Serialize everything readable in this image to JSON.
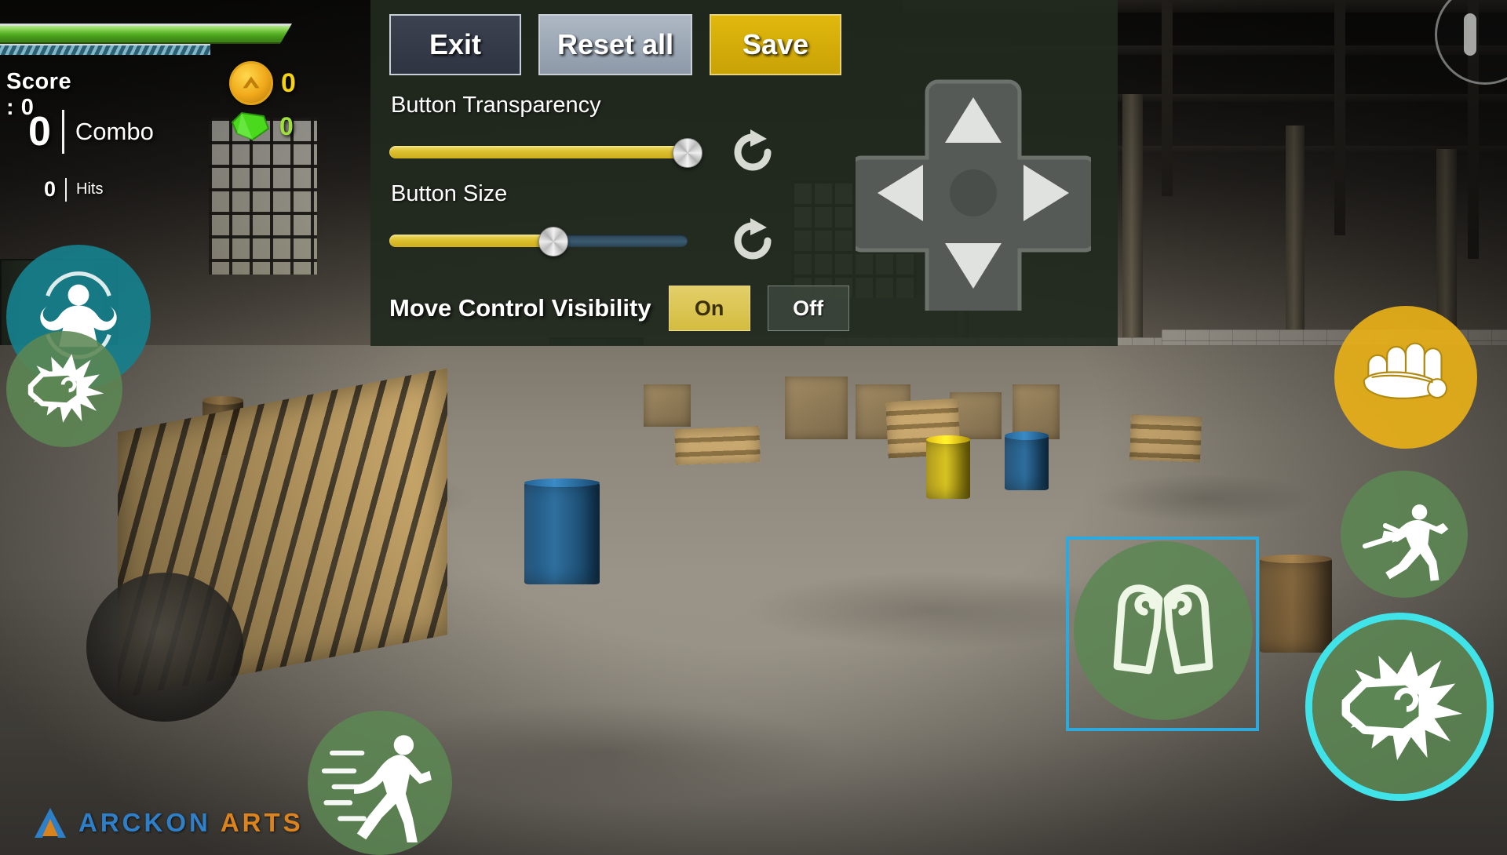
{
  "app": {
    "studio_name_primary": "ARCKON",
    "studio_name_secondary": "ARTS"
  },
  "hud": {
    "score_label": "Score : 0",
    "combo_value": "0",
    "combo_label": "Combo",
    "hits_value": "0",
    "hits_label": "Hits",
    "coin_value": "0",
    "gem_value": "0",
    "health_percent": 100,
    "stamina_percent": 72,
    "colors": {
      "health": "#4ea81f",
      "stamina": "#3f7f96",
      "coin_text": "#f5d312",
      "gem_text": "#9fe03a"
    }
  },
  "settings_panel": {
    "buttons": [
      {
        "id": "exit",
        "label": "Exit"
      },
      {
        "id": "reset",
        "label": "Reset all"
      },
      {
        "id": "save",
        "label": "Save"
      }
    ],
    "sliders": [
      {
        "id": "button-transparency",
        "label": "Button Transparency",
        "value_percent": 100,
        "reset_icon": "reset-rotate-icon"
      },
      {
        "id": "button-size",
        "label": "Button Size",
        "value_percent": 55,
        "reset_icon": "reset-rotate-icon"
      }
    ],
    "visibility": {
      "label": "Move Control Visibility",
      "options": [
        {
          "id": "on",
          "label": "On",
          "selected": true
        },
        {
          "id": "off",
          "label": "Off",
          "selected": false
        }
      ]
    },
    "colors": {
      "panel_bg": "#212a1f",
      "save_bg": "#d9b10b",
      "slider_fill": "#dcc02e",
      "slider_track": "#3b5b70",
      "toggle_on_bg": "#d9c34f"
    }
  },
  "dpad": {
    "name": "movement-dpad",
    "directions": [
      "up",
      "left",
      "right",
      "down"
    ]
  },
  "pause_button": {
    "name": "pause-button",
    "icon": "pause-icon"
  },
  "action_buttons": [
    {
      "id": "power-up",
      "icon": "flexing-muscle-icon",
      "color": "#16808c",
      "selected": false
    },
    {
      "id": "punch-left",
      "icon": "fist-impact-icon",
      "color": "#5c8653",
      "selected": false
    },
    {
      "id": "sprint",
      "icon": "running-figure-icon",
      "color": "#5c8653",
      "selected": false
    },
    {
      "id": "block",
      "icon": "two-fists-block-icon",
      "color": "#5c8653",
      "selected": true,
      "selection_style": "box"
    },
    {
      "id": "grab",
      "icon": "knuckle-fist-icon",
      "color": "#e8b018",
      "selected": false
    },
    {
      "id": "dodge",
      "icon": "dodge-roll-icon",
      "color": "#5c8653",
      "selected": false
    },
    {
      "id": "punch",
      "icon": "fist-impact-icon",
      "color": "#5c8653",
      "selected": true,
      "selection_style": "ring"
    }
  ],
  "selection_colors": {
    "box_outline": "#2ea9de",
    "ring": "#3fe3e8"
  }
}
